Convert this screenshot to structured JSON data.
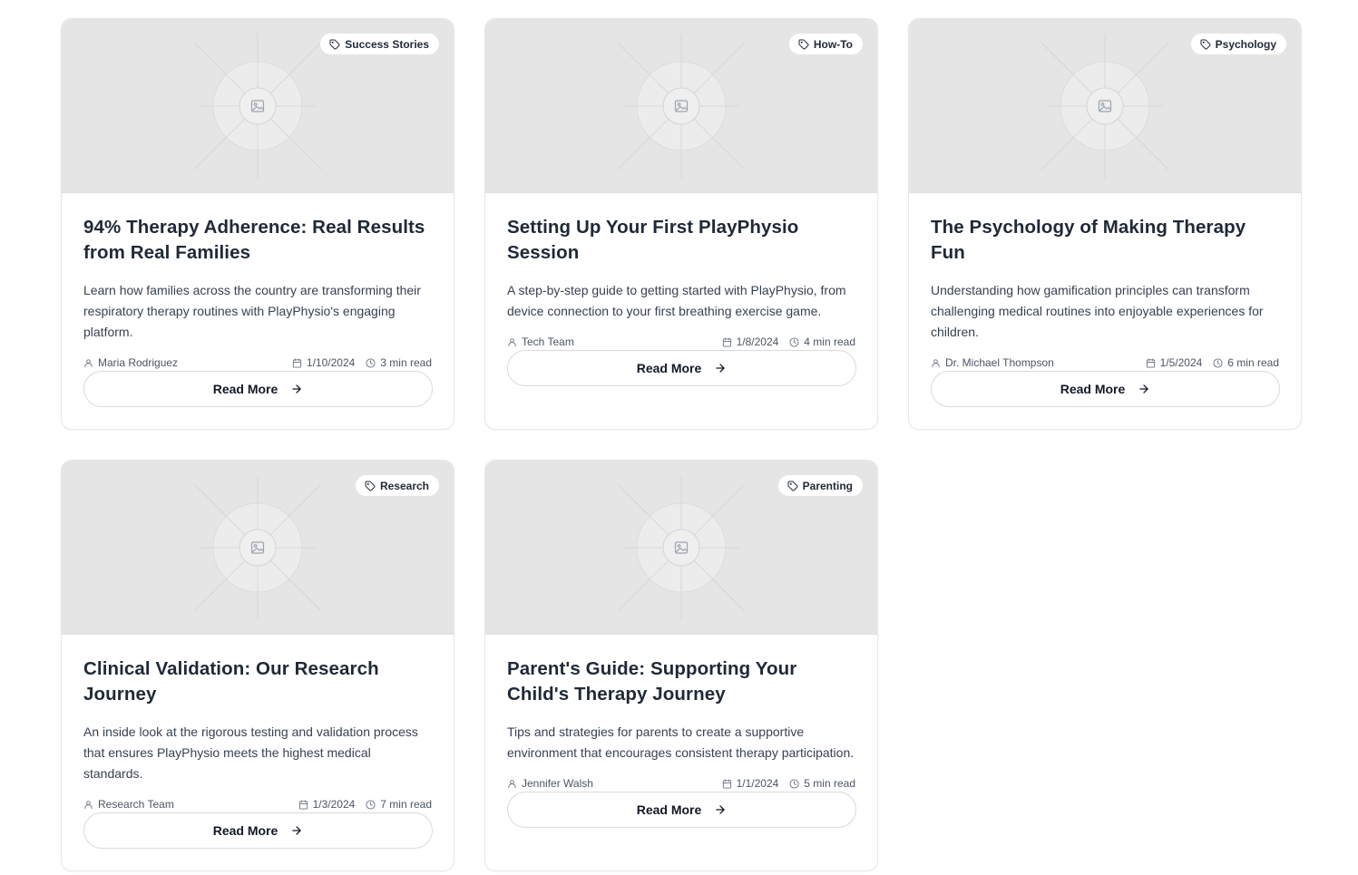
{
  "cards": [
    {
      "tag": "Success Stories",
      "title": "94% Therapy Adherence: Real Results from Real Families",
      "excerpt": "Learn how families across the country are transforming their respiratory therapy routines with PlayPhysio's engaging platform.",
      "author": "Maria Rodriguez",
      "date": "1/10/2024",
      "read_time": "3 min read",
      "cta": "Read More"
    },
    {
      "tag": "How-To",
      "title": "Setting Up Your First PlayPhysio Session",
      "excerpt": "A step-by-step guide to getting started with PlayPhysio, from device connection to your first breathing exercise game.",
      "author": "Tech Team",
      "date": "1/8/2024",
      "read_time": "4 min read",
      "cta": "Read More"
    },
    {
      "tag": "Psychology",
      "title": "The Psychology of Making Therapy Fun",
      "excerpt": "Understanding how gamification principles can transform challenging medical routines into enjoyable experiences for children.",
      "author": "Dr. Michael Thompson",
      "date": "1/5/2024",
      "read_time": "6 min read",
      "cta": "Read More"
    },
    {
      "tag": "Research",
      "title": "Clinical Validation: Our Research Journey",
      "excerpt": "An inside look at the rigorous testing and validation process that ensures PlayPhysio meets the highest medical standards.",
      "author": "Research Team",
      "date": "1/3/2024",
      "read_time": "7 min read",
      "cta": "Read More"
    },
    {
      "tag": "Parenting",
      "title": "Parent's Guide: Supporting Your Child's Therapy Journey",
      "excerpt": "Tips and strategies for parents to create a supportive environment that encourages consistent therapy participation.",
      "author": "Jennifer Walsh",
      "date": "1/1/2024",
      "read_time": "5 min read",
      "cta": "Read More"
    }
  ],
  "icons": {
    "tag": "tag-icon",
    "author": "user-icon",
    "date": "calendar-icon",
    "read_time": "clock-icon",
    "cta": "arrow-right-icon",
    "placeholder": "image-placeholder-icon"
  },
  "colors": {
    "placeholder_bg": "#e5e5e5",
    "text": "#1f2937",
    "muted": "#4b5563",
    "border": "#e6e7ea"
  }
}
